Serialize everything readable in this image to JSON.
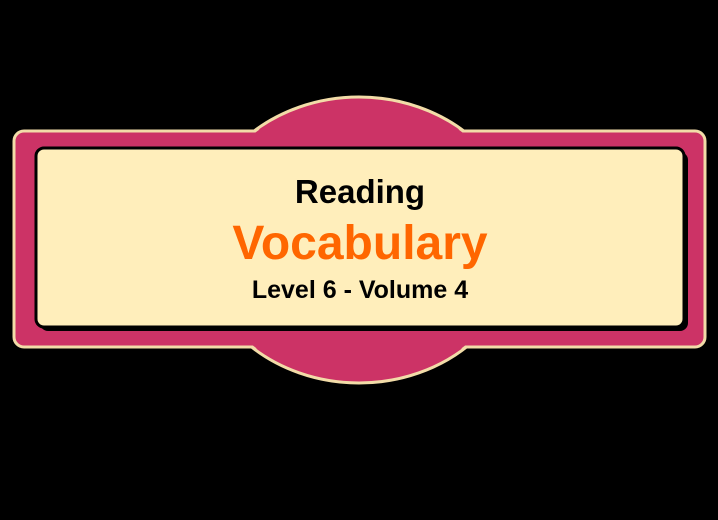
{
  "banner": {
    "line1": "Reading",
    "line2": "Vocabulary",
    "line3": "Level 6 - Volume 4"
  },
  "colors": {
    "background": "#000000",
    "frame": "#CC3366",
    "frame_outline": "#F2DCA8",
    "panel": "#FFEEBB",
    "title_accent": "#FF6600",
    "text": "#000000"
  }
}
